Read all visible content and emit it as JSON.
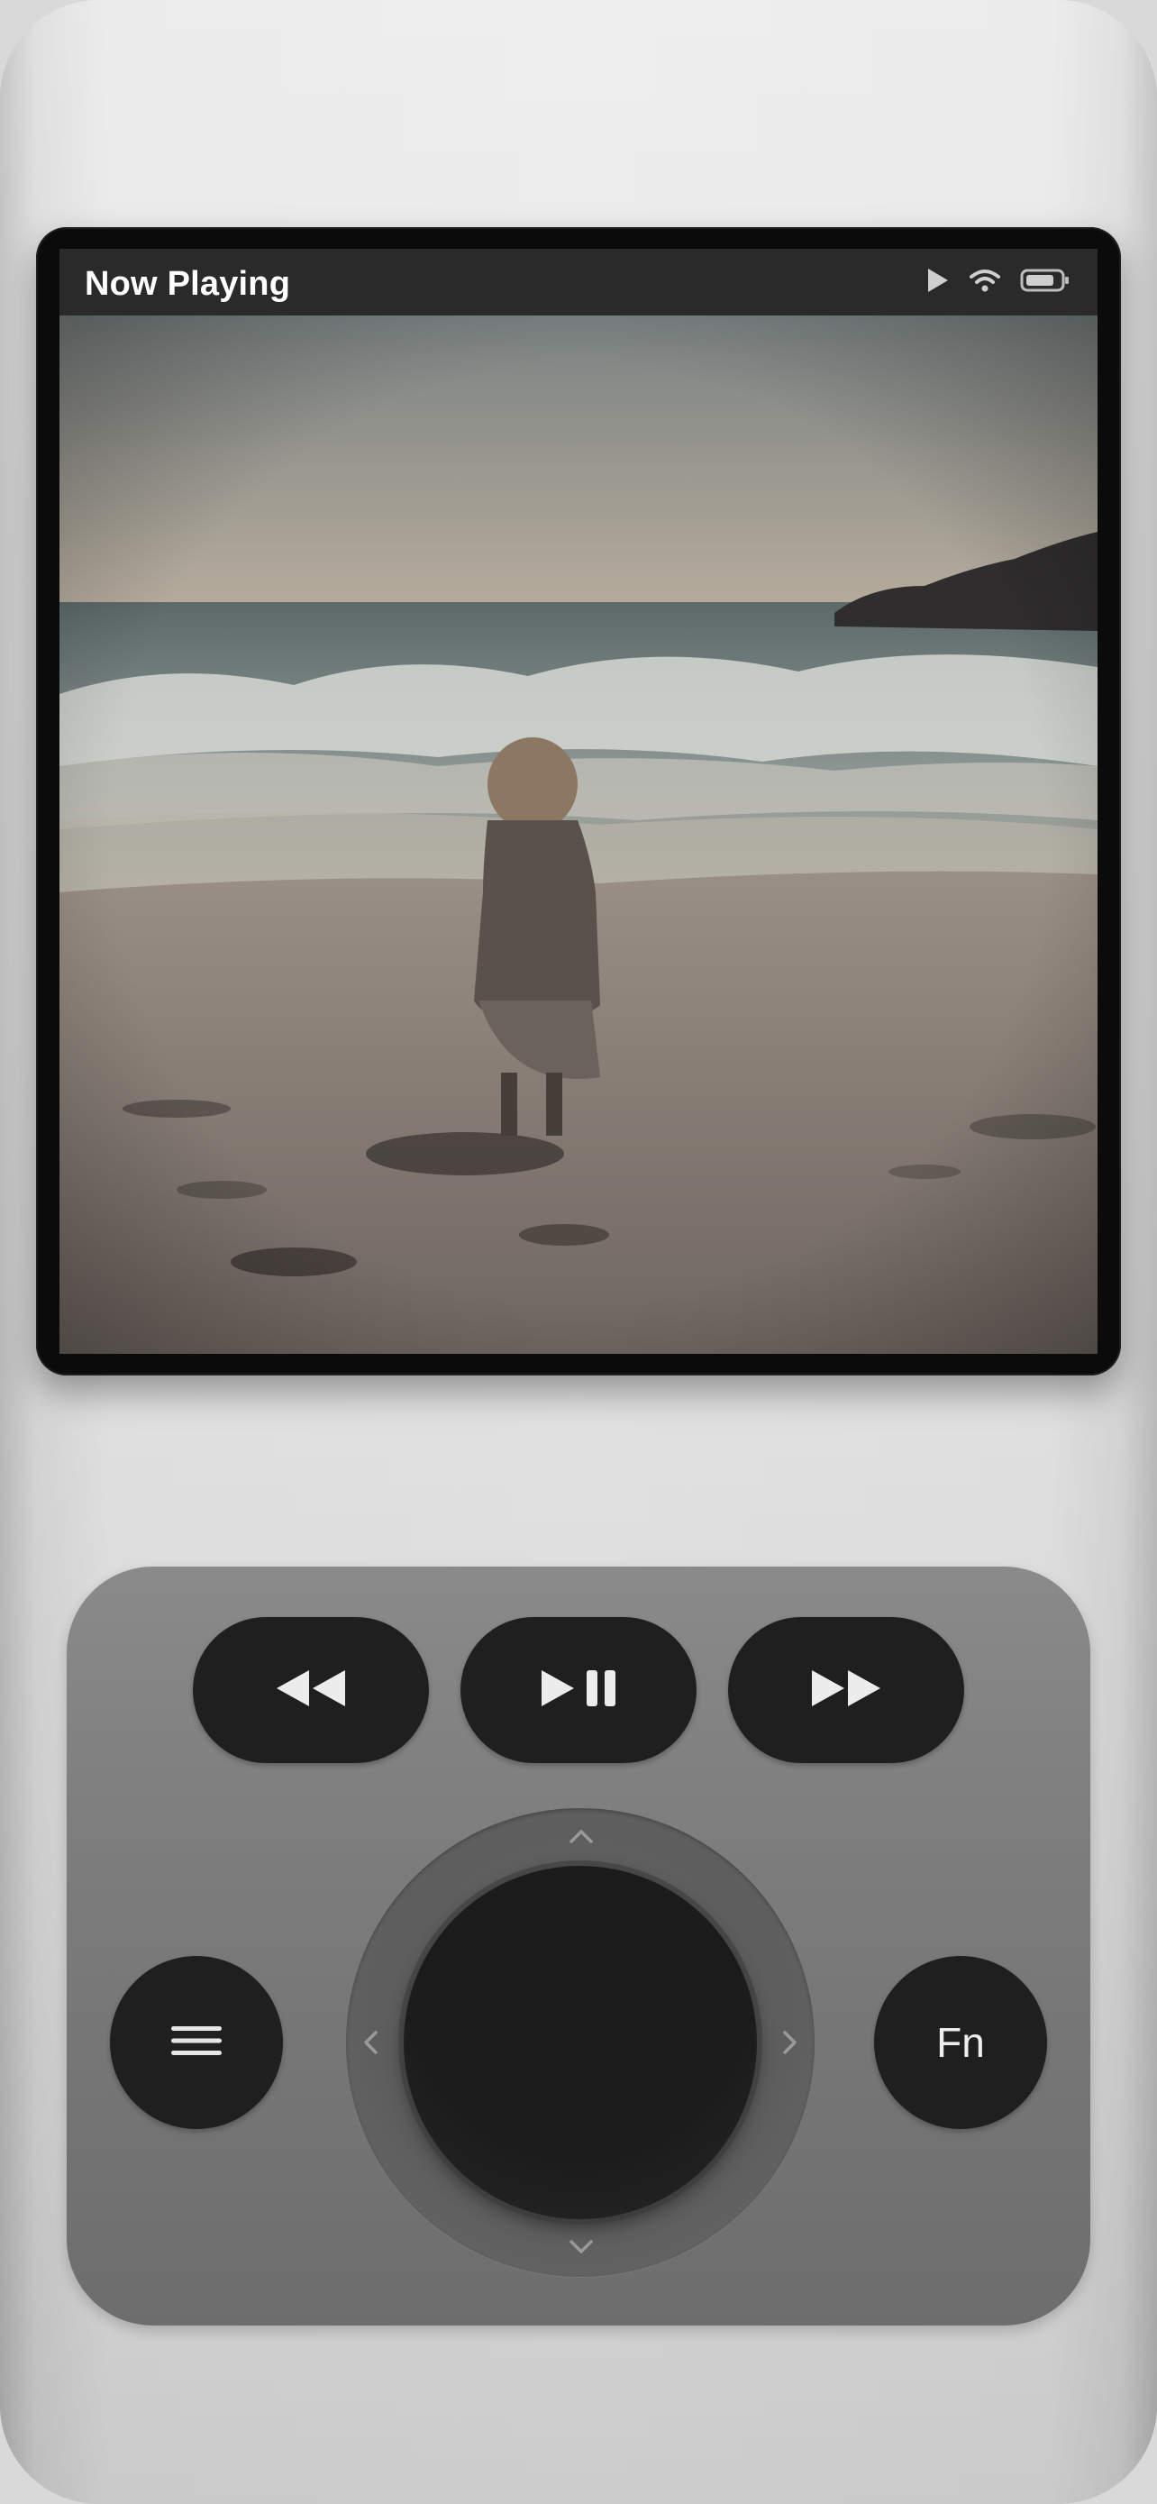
{
  "screen": {
    "title": "Now Playing",
    "status_icons": [
      "play-indicator-icon",
      "wifi-icon",
      "battery-icon"
    ]
  },
  "artwork": {
    "description_icon": "album-artwork-image"
  },
  "controls": {
    "transport": [
      "rewind-icon",
      "play-pause-icon",
      "fast-forward-icon"
    ],
    "menu_icon": "menu-icon",
    "fn_label": "Fn",
    "dpad": [
      "chevron-up-icon",
      "chevron-left-icon",
      "chevron-right-icon",
      "chevron-down-icon"
    ]
  },
  "colors": {
    "button": "#1f1f1f",
    "deck": "#7a7a7a",
    "status_bar": "#2a2a2a"
  }
}
